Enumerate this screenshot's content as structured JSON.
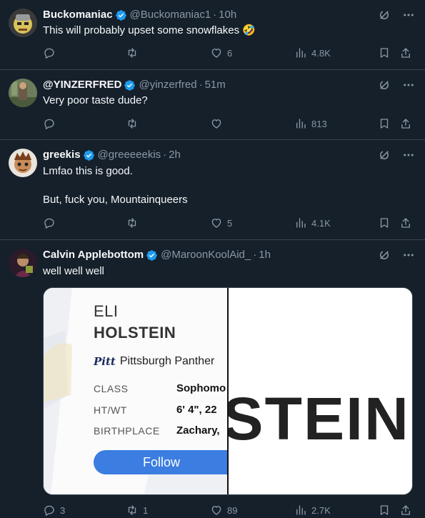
{
  "tweets": [
    {
      "name": "Buckomaniac",
      "handle": "@Buckomaniac1",
      "time": "10h",
      "text": "This will probably upset some snowflakes 🤣",
      "replies": "",
      "retweets": "",
      "likes": "6",
      "views": "4.8K"
    },
    {
      "name": "@YINZERFRED",
      "handle": "@yinzerfred",
      "time": "51m",
      "text": "Very poor taste dude?",
      "replies": "",
      "retweets": "",
      "likes": "",
      "views": "813"
    },
    {
      "name": "greekis",
      "handle": "@greeeeekis",
      "time": "2h",
      "text": "Lmfao this is good.\n\nBut, fuck you, Mountainqueers",
      "replies": "",
      "retweets": "",
      "likes": "5",
      "views": "4.1K"
    },
    {
      "name": "Calvin Applebottom",
      "handle": "@MaroonKoolAid_",
      "time": "1h",
      "text": "well well well",
      "replies": "3",
      "retweets": "1",
      "likes": "89",
      "views": "2.7K"
    }
  ],
  "separator": "·",
  "media": {
    "first_name": "ELI",
    "last_name": "HOLSTEIN",
    "school_logo": "Pitt",
    "school": "Pittsburgh Panther",
    "rows": [
      {
        "label": "CLASS",
        "value": "Sophomo"
      },
      {
        "label": "HT/WT",
        "value": "6' 4\", 22"
      },
      {
        "label": "BIRTHPLACE",
        "value": "Zachary,"
      }
    ],
    "follow_label": "Follow",
    "big_text": "STEIN"
  },
  "colors": {
    "background": "#15202b",
    "border": "#38444d",
    "muted": "#8b98a5",
    "verified": "#1d9bf0",
    "follow": "#3b7de0"
  }
}
